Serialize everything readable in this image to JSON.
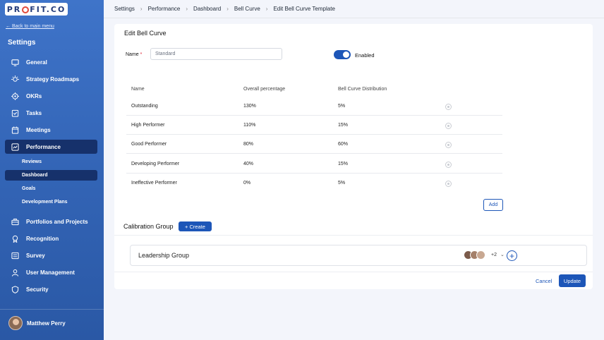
{
  "brand": {
    "logo_text": "PR",
    "logo_text2": "FIT.CO"
  },
  "sidebar": {
    "back_link": "← Back to main menu",
    "title": "Settings",
    "items": [
      {
        "label": "General",
        "icon": "monitor-icon"
      },
      {
        "label": "Strategy Roadmaps",
        "icon": "bulb-icon"
      },
      {
        "label": "OKRs",
        "icon": "target-icon"
      },
      {
        "label": "Tasks",
        "icon": "checklist-icon"
      },
      {
        "label": "Meetings",
        "icon": "calendar-icon"
      },
      {
        "label": "Performance",
        "icon": "chart-icon"
      },
      {
        "label": "Portfolios and Projects",
        "icon": "briefcase-icon"
      },
      {
        "label": "Recognition",
        "icon": "award-icon"
      },
      {
        "label": "Survey",
        "icon": "survey-icon"
      },
      {
        "label": "User Management",
        "icon": "user-icon"
      },
      {
        "label": "Security",
        "icon": "shield-icon"
      }
    ],
    "sub_items": [
      "Reviews",
      "Dashboard",
      "Goals",
      "Development Plans"
    ],
    "user_name": "Matthew Perry"
  },
  "breadcrumb": [
    "Settings",
    "Performance",
    "Dashboard",
    "Bell Curve",
    "Edit Bell Curve Template"
  ],
  "form": {
    "title": "Edit Bell Curve",
    "name_label": "Name",
    "name_required": "*",
    "name_value": "Standard",
    "toggle_label": "Enabled",
    "toggle_on": true
  },
  "table": {
    "columns": [
      "Name",
      "Overall percentage",
      "Bell Curve Distribution"
    ],
    "rows": [
      {
        "name": "Outstanding",
        "overall": "130%",
        "distribution": "5%"
      },
      {
        "name": "High Performer",
        "overall": "110%",
        "distribution": "15%"
      },
      {
        "name": "Good Performer",
        "overall": "80%",
        "distribution": "60%"
      },
      {
        "name": "Developing Performer",
        "overall": "40%",
        "distribution": "15%"
      },
      {
        "name": "Ineffective Performer",
        "overall": "0%",
        "distribution": "5%"
      }
    ],
    "add_label": "Add"
  },
  "calibration": {
    "label": "Calibration Group",
    "create_label": "+ Create",
    "group_name": "Leadership Group",
    "more_count": "+2"
  },
  "actions": {
    "cancel": "Cancel",
    "update": "Update"
  },
  "colors": {
    "primary": "#1d56b8",
    "sidebar_active": "#16316b",
    "logo_accent": "#e14a3b"
  }
}
